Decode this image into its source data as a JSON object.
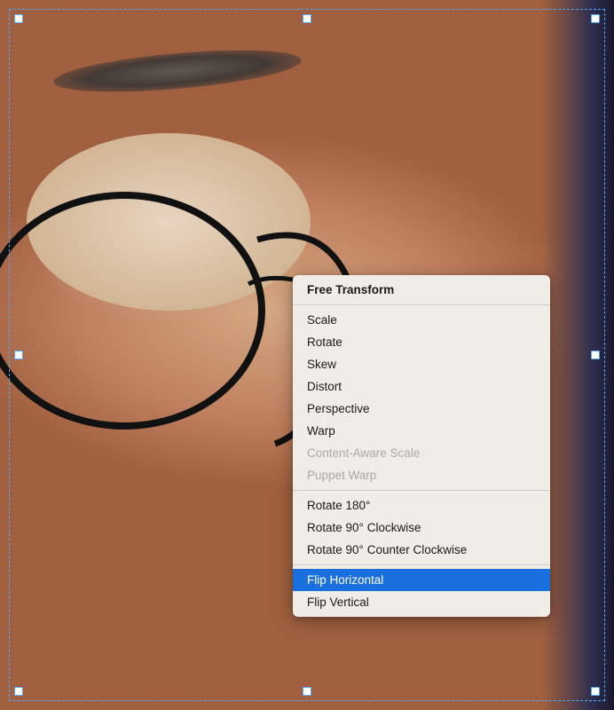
{
  "canvas": {
    "background_color": "#c09070"
  },
  "selection": {
    "handles": [
      "tl",
      "tm",
      "tr",
      "ml",
      "mr",
      "bl",
      "bm",
      "br"
    ],
    "border_color": "#4fa8ff"
  },
  "context_menu": {
    "items": [
      {
        "id": "free-transform",
        "label": "Free Transform",
        "style": "bold",
        "disabled": false,
        "highlighted": false
      },
      {
        "id": "divider-1",
        "type": "divider"
      },
      {
        "id": "scale",
        "label": "Scale",
        "style": "normal",
        "disabled": false,
        "highlighted": false
      },
      {
        "id": "rotate",
        "label": "Rotate",
        "style": "normal",
        "disabled": false,
        "highlighted": false
      },
      {
        "id": "skew",
        "label": "Skew",
        "style": "normal",
        "disabled": false,
        "highlighted": false
      },
      {
        "id": "distort",
        "label": "Distort",
        "style": "normal",
        "disabled": false,
        "highlighted": false
      },
      {
        "id": "perspective",
        "label": "Perspective",
        "style": "normal",
        "disabled": false,
        "highlighted": false
      },
      {
        "id": "warp",
        "label": "Warp",
        "style": "normal",
        "disabled": false,
        "highlighted": false
      },
      {
        "id": "content-aware-scale",
        "label": "Content-Aware Scale",
        "style": "normal",
        "disabled": true,
        "highlighted": false
      },
      {
        "id": "puppet-warp",
        "label": "Puppet Warp",
        "style": "normal",
        "disabled": true,
        "highlighted": false
      },
      {
        "id": "divider-2",
        "type": "divider"
      },
      {
        "id": "rotate-180",
        "label": "Rotate 180°",
        "style": "normal",
        "disabled": false,
        "highlighted": false
      },
      {
        "id": "rotate-90-cw",
        "label": "Rotate 90° Clockwise",
        "style": "normal",
        "disabled": false,
        "highlighted": false
      },
      {
        "id": "rotate-90-ccw",
        "label": "Rotate 90° Counter Clockwise",
        "style": "normal",
        "disabled": false,
        "highlighted": false
      },
      {
        "id": "divider-3",
        "type": "divider"
      },
      {
        "id": "flip-horizontal",
        "label": "Flip Horizontal",
        "style": "normal",
        "disabled": false,
        "highlighted": true
      },
      {
        "id": "flip-vertical",
        "label": "Flip Vertical",
        "style": "normal",
        "disabled": false,
        "highlighted": false
      }
    ]
  }
}
